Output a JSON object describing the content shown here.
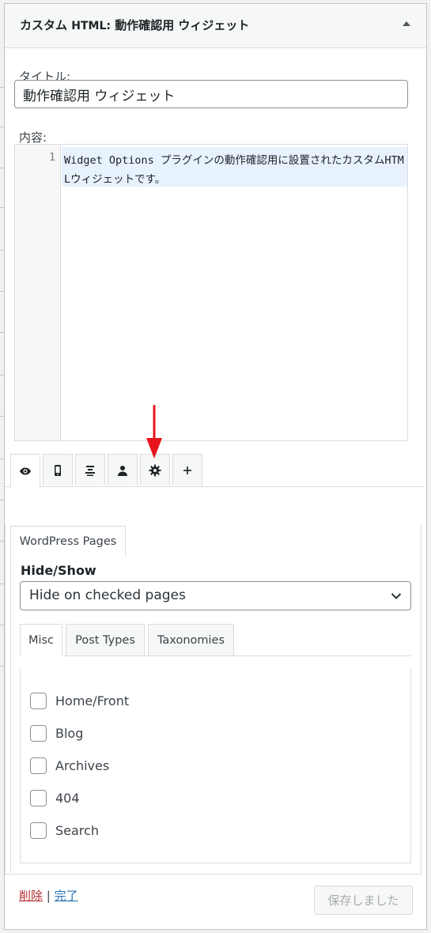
{
  "widget": {
    "title_prefix": "カスタム",
    "title_html": "HTML:",
    "title_name": "動作確認用 ウィジェット"
  },
  "form": {
    "title_label": "タイトル:",
    "title_value": "動作確認用 ウィジェット",
    "content_label": "内容:"
  },
  "editor": {
    "line_number": "1",
    "code": "Widget Options プラグインの動作確認用に設置されたカスタムHTMLウィジェットです。"
  },
  "icon_tabs": [
    {
      "icon": "eye-icon",
      "active": true
    },
    {
      "icon": "mobile-icon",
      "active": false
    },
    {
      "icon": "align-center-icon",
      "active": false
    },
    {
      "icon": "user-icon",
      "active": false
    },
    {
      "icon": "gear-icon",
      "active": false
    },
    {
      "icon": "plus-icon",
      "active": false
    }
  ],
  "options": {
    "section_tab": "WordPress Pages",
    "hide_show_label": "Hide/Show",
    "select_value": "Hide on checked pages",
    "sub_tabs": [
      "Misc",
      "Post Types",
      "Taxonomies"
    ],
    "checkboxes": [
      "Home/Front",
      "Blog",
      "Archives",
      "404",
      "Search"
    ]
  },
  "footer": {
    "delete_label": "削除",
    "separator": "|",
    "done_label": "完了",
    "save_label": "保存しました"
  },
  "colors": {
    "annotation_arrow": "#e8141b",
    "delete_link": "#b32d2e",
    "done_link": "#2271b1"
  }
}
